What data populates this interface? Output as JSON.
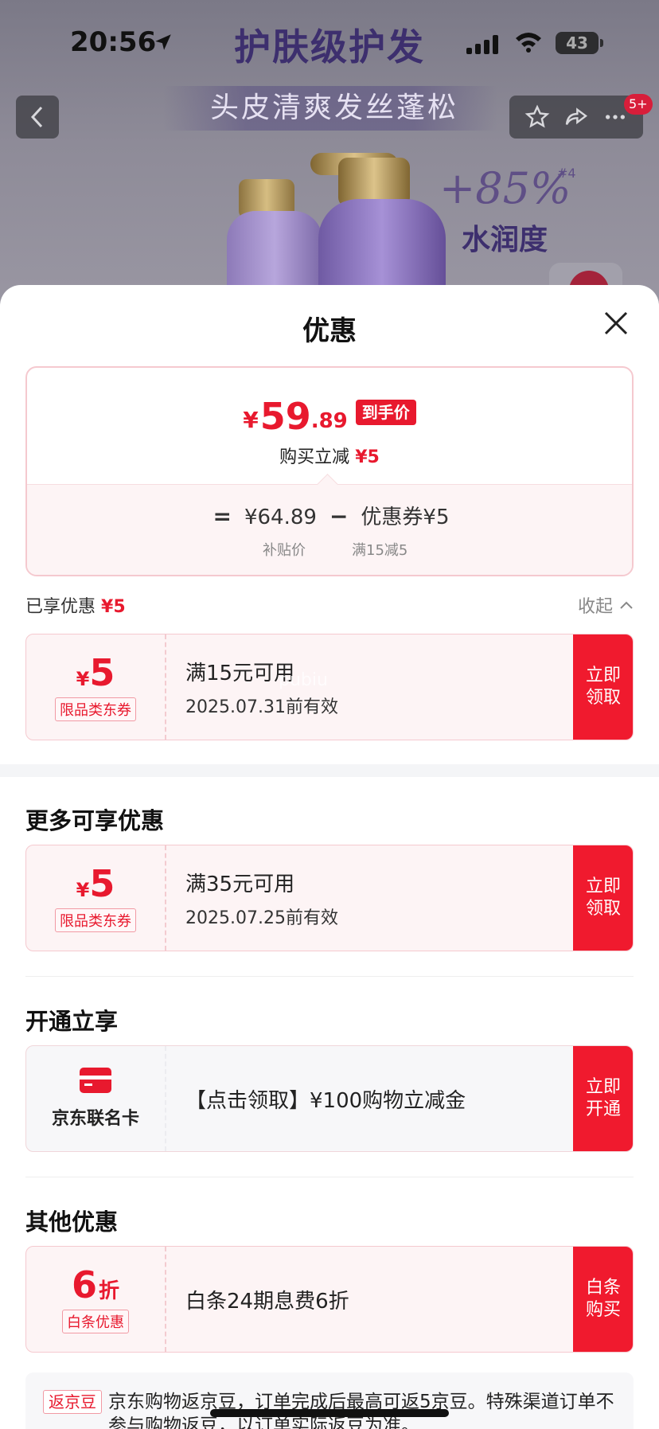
{
  "status_bar": {
    "time": "20:56",
    "battery": "43"
  },
  "product_banner": {
    "title": "护肤级护发",
    "subtitle": "头皮清爽发丝蓬松",
    "moisture_value": "+85%",
    "moisture_note": "#4",
    "moisture_label": "水润度",
    "notification_badge": "5+"
  },
  "sheet": {
    "title": "优惠",
    "price": {
      "currency": "¥",
      "integer": "59",
      "decimal": ".89",
      "tag": "到手价",
      "instant_label": "购买立减",
      "instant_amount": "¥5",
      "formula_equals": "=",
      "base_price": "¥64.89",
      "formula_minus": "−",
      "coupon_part": "优惠券¥5",
      "base_label": "补贴价",
      "coupon_label": "满15减5"
    },
    "enjoyed": {
      "label": "已享优惠",
      "amount": "¥5",
      "collapse_label": "收起"
    },
    "enjoyed_coupon": {
      "currency": "¥",
      "amount": "5",
      "type": "限品类东券",
      "condition": "满15元可用",
      "expiry": "2025.07.31前有效",
      "button": "立即领取"
    },
    "more_title": "更多可享优惠",
    "more_coupon": {
      "currency": "¥",
      "amount": "5",
      "type": "限品类东券",
      "condition": "满35元可用",
      "expiry": "2025.07.25前有效",
      "button": "立即领取"
    },
    "open_title": "开通立享",
    "open_offer": {
      "card_name": "京东联名卡",
      "text": "【点击领取】¥100购物立减金",
      "button": "立即开通"
    },
    "other_title": "其他优惠",
    "other_offer": {
      "amount": "6",
      "unit": "折",
      "type": "白条优惠",
      "text": "白条24期息费6折",
      "button": "白条购买"
    },
    "bean": {
      "tag": "返京豆",
      "text": "京东购物返京豆，订单完成后最高可返5京豆。特殊渠道订单不参与购物返豆，以订单实际返豆为准。"
    },
    "watermark": "pubiu"
  },
  "colors": {
    "accent": "#e8192e",
    "button_red": "#f01a2e"
  }
}
